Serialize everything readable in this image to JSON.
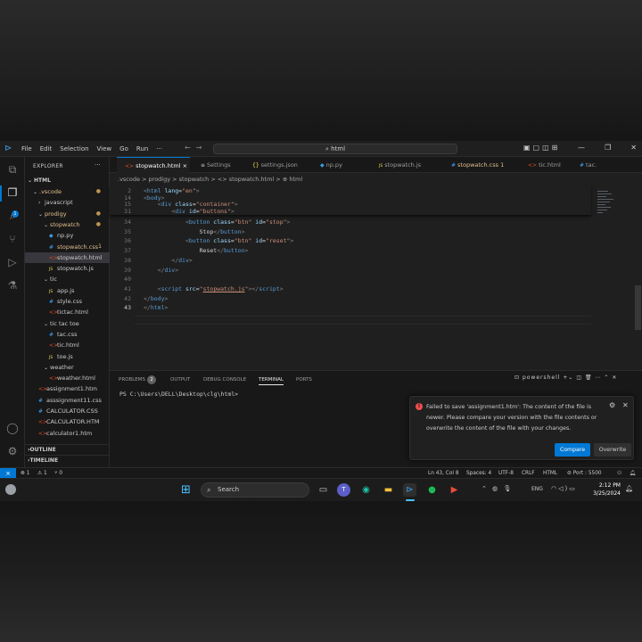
{
  "titlebar": {
    "menu": [
      "File",
      "Edit",
      "Selection",
      "View",
      "Go",
      "Run",
      "···"
    ],
    "search": "⌕ html"
  },
  "explorer": {
    "title": "EXPLORER",
    "dots": "···",
    "root": "HTML",
    "items": [
      {
        "label": ".vscode",
        "type": "folder-open",
        "depth": 1,
        "modified": true
      },
      {
        "label": "javascript",
        "type": "folder",
        "depth": 2
      },
      {
        "label": "prodigy",
        "type": "folder-open",
        "depth": 2,
        "modified": true
      },
      {
        "label": "stopwatch",
        "type": "folder-open",
        "depth": 3,
        "modified": true
      },
      {
        "label": "np.py",
        "type": "py",
        "depth": 4
      },
      {
        "label": "stopwatch.css",
        "type": "css",
        "depth": 4,
        "modified": true,
        "count": "1"
      },
      {
        "label": "stopwatch.html",
        "type": "html",
        "depth": 4,
        "selected": true
      },
      {
        "label": "stopwatch.js",
        "type": "js",
        "depth": 4
      },
      {
        "label": "tic",
        "type": "folder-open",
        "depth": 3
      },
      {
        "label": "app.js",
        "type": "js",
        "depth": 4
      },
      {
        "label": "style.css",
        "type": "css",
        "depth": 4
      },
      {
        "label": "tictac.html",
        "type": "html",
        "depth": 4
      },
      {
        "label": "tic tac toe",
        "type": "folder-open",
        "depth": 3
      },
      {
        "label": "tac.css",
        "type": "css",
        "depth": 4
      },
      {
        "label": "tic.html",
        "type": "html",
        "depth": 4
      },
      {
        "label": "toe.js",
        "type": "js",
        "depth": 4
      },
      {
        "label": "weather",
        "type": "folder-open",
        "depth": 3
      },
      {
        "label": "weather.html",
        "type": "html",
        "depth": 4
      },
      {
        "label": "assignment1.htm",
        "type": "html",
        "depth": 2
      },
      {
        "label": "asssignment11.css",
        "type": "css",
        "depth": 2
      },
      {
        "label": "CALCULATOR.CSS",
        "type": "css",
        "depth": 2
      },
      {
        "label": "CALCULATOR.HTM",
        "type": "html",
        "depth": 2
      },
      {
        "label": "calculator1.htm",
        "type": "html",
        "depth": 2
      }
    ],
    "outline": "OUTLINE",
    "timeline": "TIMELINE"
  },
  "tabs": [
    {
      "label": "stopwatch.html",
      "icon": "<>",
      "active": true,
      "close": "×"
    },
    {
      "label": "Settings",
      "icon": "≡"
    },
    {
      "label": "settings.json",
      "icon": "{}"
    },
    {
      "label": "np.py",
      "icon": "◆"
    },
    {
      "label": "stopwatch.js",
      "icon": "JS"
    },
    {
      "label": "stopwatch.css 1",
      "icon": "#",
      "modified": true
    },
    {
      "label": "tic.html",
      "icon": "<>"
    },
    {
      "label": "tac.",
      "icon": "#"
    }
  ],
  "breadcrumb": ".vscode > prodigy > stopwatch > <> stopwatch.html > ⊕ html",
  "editor": {
    "sticky": [
      {
        "num": "2",
        "html": "<span class='tag'>&lt;</span><span class='tn'>html</span> <span class='at'>lang</span>=<span class='st'>\"en\"</span><span class='tag'>&gt;</span>"
      },
      {
        "num": "14",
        "html": "<span class='tag'>&lt;</span><span class='tn'>body</span><span class='tag'>&gt;</span>"
      },
      {
        "num": "15",
        "html": "    <span class='tag'>&lt;</span><span class='tn'>div</span> <span class='at'>class</span>=<span class='st'>\"container\"</span><span class='tag'>&gt;</span>"
      },
      {
        "num": "31",
        "html": "        <span class='tag'>&lt;</span><span class='tn'>div</span> <span class='at'>id</span>=<span class='st'>\"buttons\"</span><span class='tag'>&gt;</span>"
      }
    ],
    "lines": [
      {
        "num": "34",
        "html": "            <span class='tag'>&lt;</span><span class='tn'>button</span> <span class='at'>class</span>=<span class='st'>\"btn\"</span> <span class='at'>id</span>=<span class='st'>\"stop\"</span><span class='tag'>&gt;</span>"
      },
      {
        "num": "35",
        "html": "                Stop<span class='tag'>&lt;/</span><span class='tn'>button</span><span class='tag'>&gt;</span>"
      },
      {
        "num": "36",
        "html": "            <span class='tag'>&lt;</span><span class='tn'>button</span> <span class='at'>class</span>=<span class='st'>\"btn\"</span> <span class='at'>id</span>=<span class='st'>\"reset\"</span><span class='tag'>&gt;</span>"
      },
      {
        "num": "37",
        "html": "                Reset<span class='tag'>&lt;/</span><span class='tn'>button</span><span class='tag'>&gt;</span>"
      },
      {
        "num": "38",
        "html": "        <span class='tag'>&lt;/</span><span class='tn'>div</span><span class='tag'>&gt;</span>"
      },
      {
        "num": "39",
        "html": "    <span class='tag'>&lt;/</span><span class='tn'>div</span><span class='tag'>&gt;</span>"
      },
      {
        "num": "40",
        "html": ""
      },
      {
        "num": "41",
        "html": "    <span class='tag'>&lt;</span><span class='tn'>script</span> <span class='at'>src</span>=<span class='st'>\"<u>stopwatch.js</u>\"</span><span class='tag'>&gt;&lt;/</span><span class='tn'>script</span><span class='tag'>&gt;</span>"
      },
      {
        "num": "42",
        "html": "<span class='tag'>&lt;/</span><span class='tn'>body</span><span class='tag'>&gt;</span>"
      },
      {
        "num": "43",
        "html": "<span class='tag'>&lt;/</span><span class='tn'>html</span><span class='tag'>&gt;</span>",
        "current": true
      }
    ]
  },
  "panel": {
    "tabs": [
      "PROBLEMS",
      "OUTPUT",
      "DEBUG CONSOLE",
      "TERMINAL",
      "PORTS"
    ],
    "problems_count": "2",
    "active_tab": "TERMINAL",
    "shell": "powershell",
    "prompt": "PS C:\\Users\\DELL\\Desktop\\clg\\html> "
  },
  "notification": {
    "message": "Failed to save 'assignment1.htm': The content of the file is newer. Please compare your version with the file contents or overwrite the content of the file with your changes.",
    "compare": "Compare",
    "overwrite": "Overwrite"
  },
  "statusbar": {
    "errors": "⊗ 1",
    "warnings": "⚠ 1",
    "ports_info": "⑂ 0",
    "position": "Ln 43, Col 8",
    "spaces": "Spaces: 4",
    "encoding": "UTF-8",
    "eol": "CRLF",
    "language": "HTML",
    "port": "⊘ Port : 5500"
  },
  "taskbar": {
    "search": "Search",
    "lang": "ENG",
    "time": "2:12 PM",
    "date": "3/25/2024"
  },
  "colors": {
    "accent": "#0078d4",
    "error": "#f14c4c",
    "modified": "#e2c08d"
  }
}
